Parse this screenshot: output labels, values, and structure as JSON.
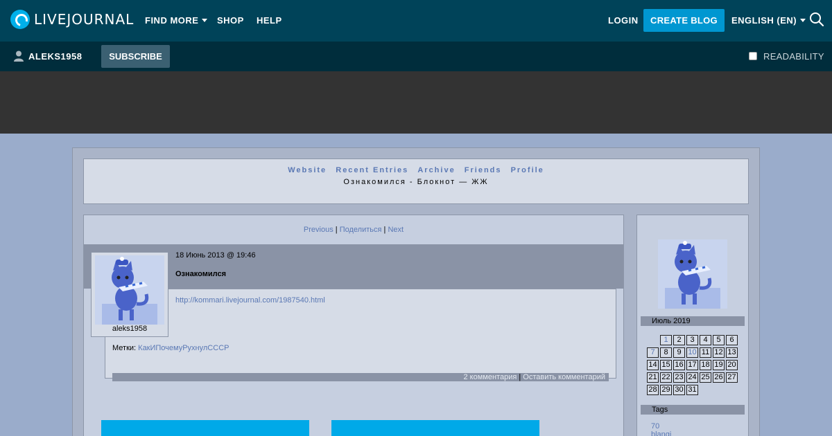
{
  "topbar": {
    "logo": "LIVEJOURNAL",
    "nav": [
      "FIND MORE",
      "SHOP",
      "HELP"
    ],
    "login": "LOGIN",
    "create_blog": "CREATE BLOG",
    "language": "ENGLISH (EN)"
  },
  "subbar": {
    "username": "ALEKS1958",
    "subscribe": "SUBSCRIBE",
    "readability": "READABILITY"
  },
  "journal": {
    "links": [
      "Website",
      "Recent Entries",
      "Archive",
      "Friends",
      "Profile"
    ],
    "title": "Ознакомился - Блокнот — ЖЖ"
  },
  "entry": {
    "nav_previous": "Previous",
    "nav_share": "Поделиться",
    "nav_next": "Next",
    "date": "18 Июнь 2013 @ 19:46",
    "subject": "Ознакомился",
    "link": "http://kommari.livejournal.com/1987540.html",
    "tags_label": "Метки:",
    "tag": "КакИПочемуРухнулСССР",
    "comments": "2 комментария",
    "leave_comment": "Оставить комментарий",
    "userpic_name": "aleks1958"
  },
  "sidebar": {
    "month": "Июль 2019",
    "calendar": [
      [
        "",
        "1",
        "2",
        "3",
        "4",
        "5",
        "6"
      ],
      [
        "7",
        "8",
        "9",
        "10",
        "11",
        "12",
        "13"
      ],
      [
        "14",
        "15",
        "16",
        "17",
        "18",
        "19",
        "20"
      ],
      [
        "21",
        "22",
        "23",
        "24",
        "25",
        "26",
        "27"
      ],
      [
        "28",
        "29",
        "30",
        "31",
        "",
        "",
        ""
      ]
    ],
    "linked_days": [
      "1",
      "7",
      "10"
    ],
    "tags_label": "Tags",
    "tags": [
      "70",
      "blanqi"
    ]
  },
  "colors": {
    "header_bg": "#004359",
    "subbar_bg": "#002d3c",
    "accent": "#0097d1",
    "page_bg": "#9aaccb",
    "link": "#5a78b4"
  }
}
